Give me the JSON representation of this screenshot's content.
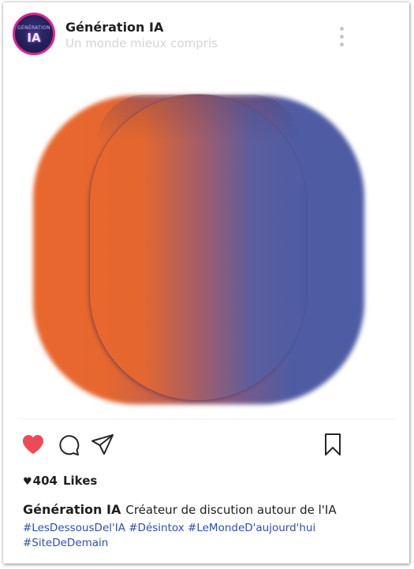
{
  "post": {
    "account_name": "Génération IA",
    "account_subtitle": "Un monde mieux compris",
    "avatar": {
      "top_text": "GÉNÉRATION",
      "main_text": "IA"
    },
    "more_icon": "more-vertical-icon"
  },
  "actions": {
    "like_icon": "heart-icon",
    "comment_icon": "comment-icon",
    "share_icon": "send-icon",
    "save_icon": "bookmark-icon",
    "like_color": "#ed4956"
  },
  "likes": {
    "heart": "♥",
    "count": "404",
    "label": "Likes"
  },
  "caption": {
    "author": "Génération IA",
    "text": "Créateur de discution autour de l'IA",
    "hashtags": [
      "#LesDessousDel'IA",
      "#Désintox",
      "#LeMondeD'aujourd'hui",
      "#SiteDeDemain"
    ]
  },
  "colors": {
    "orange": "#e8672d",
    "blue": "#4e5ca4",
    "avatar_ring": "#e0248f",
    "hashtag": "#2b4fb5"
  }
}
